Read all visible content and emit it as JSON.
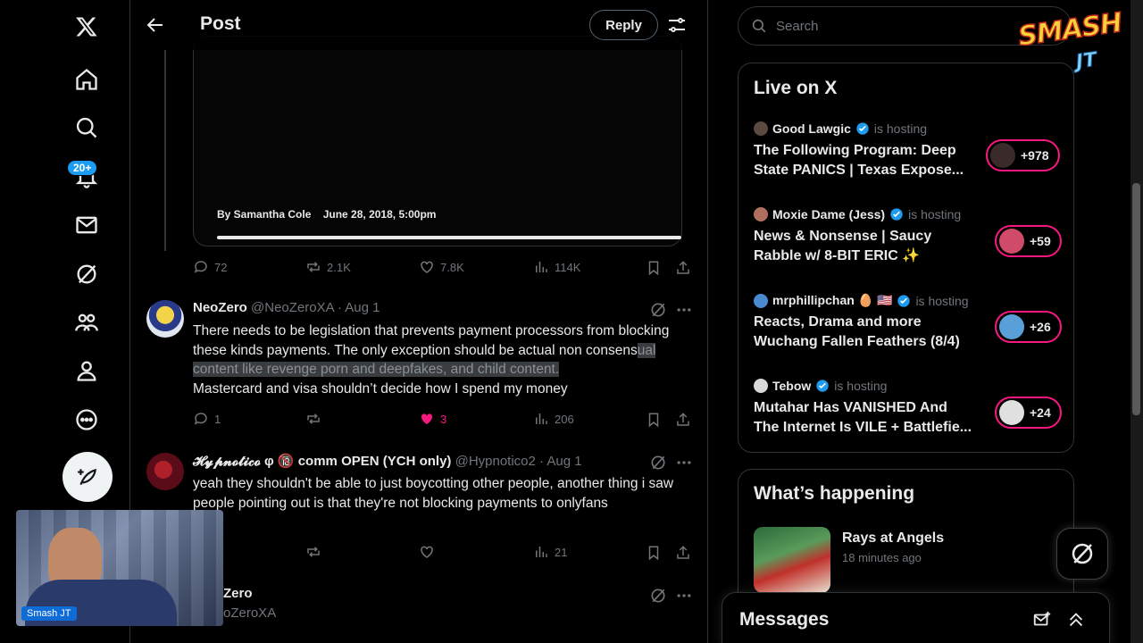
{
  "header": {
    "title": "Post",
    "reply_label": "Reply"
  },
  "nav": {
    "notifications_badge": "20+"
  },
  "article_card": {
    "author": "By Samantha Cole",
    "date": "June 28, 2018, 5:00pm"
  },
  "main_post_stats": {
    "replies": "72",
    "reposts": "2.1K",
    "likes": "7.8K",
    "views": "114K"
  },
  "replies": [
    {
      "name": "NeoZero",
      "handle": "@NeoZeroXA",
      "date": "· Aug 1",
      "text_before": "There needs to be legislation that prevents payment processors from blocking these kinds payments. The only exception should be actual non consens",
      "text_highlight": "ual content like revenge porn and deepfakes, and child content.",
      "text_after": "Mastercard and visa shouldn’t decide how I spend my money",
      "replies": "1",
      "reposts": "",
      "likes": "3",
      "views": "206"
    },
    {
      "name": "𝓗𝔂𝓹𝓷𝓸𝓽𝓲𝓬𝓸 φ 🔞 comm OPEN (YCH only)",
      "handle": "@Hypnotico2",
      "date": "· Aug 1",
      "text": "yeah they shouldn't be able to just boycotting other people, another thing i saw people pointing out is that they're not blocking payments to onlyfans",
      "views": "21"
    },
    {
      "name_partial": "Zero",
      "handle_partial": "oZeroXA"
    }
  ],
  "search": {
    "placeholder": "Search"
  },
  "live": {
    "title": "Live on X",
    "hosting_label": "is hosting",
    "items": [
      {
        "host": "Good Lawgic",
        "title": "The Following Program: Deep State PANICS | Texas Expose...",
        "count": "+978"
      },
      {
        "host": "Moxie Dame (Jess)",
        "title": "News & Nonsense | Saucy Rabble w/ 8-BIT ERIC ✨",
        "count": "+59"
      },
      {
        "host": "mrphillipchan 🥚 🇺🇸",
        "title": "Reacts, Drama and more Wuchang Fallen Feathers (8/4)",
        "count": "+26"
      },
      {
        "host": "Tebow",
        "title": "Mutahar Has VANISHED And The Internet Is VILE + Battlefie...",
        "count": "+24"
      }
    ]
  },
  "happening": {
    "title": "What’s happening",
    "item_title": "Rays at Angels",
    "item_time": "18 minutes ago"
  },
  "messages": {
    "title": "Messages"
  },
  "webcam": {
    "label": "Smash JT"
  },
  "logo": {
    "line1": "SMASH",
    "line2": "JT"
  },
  "colors": {
    "accent": "#1d9bf0",
    "like": "#f91880",
    "border": "#2f3336",
    "muted": "#71767b"
  }
}
